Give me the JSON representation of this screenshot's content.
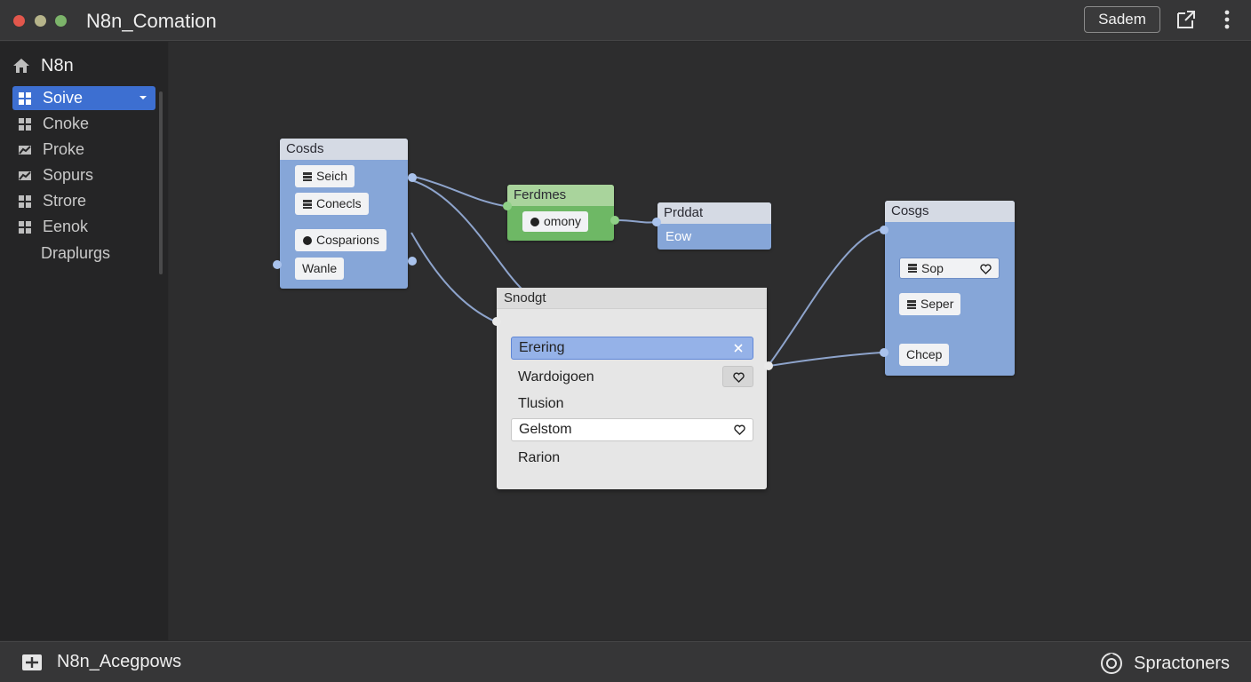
{
  "window": {
    "title": "N8n_Comation",
    "actions": {
      "primary_label": "Sadem",
      "export_icon": "export-icon",
      "menu_icon": "kebab-icon"
    }
  },
  "sidebar": {
    "home": {
      "label": "N8n",
      "icon": "home-icon"
    },
    "items": [
      {
        "label": "Soive",
        "icon": "grid-icon",
        "active": true
      },
      {
        "label": "Cnoke",
        "icon": "grid-icon"
      },
      {
        "label": "Proke",
        "icon": "chart-icon"
      },
      {
        "label": "Sopurs",
        "icon": "chart-icon"
      },
      {
        "label": "Strore",
        "icon": "grid-icon"
      },
      {
        "label": "Eenok",
        "icon": "grid-icon"
      },
      {
        "label": "Draplurgs",
        "icon": ""
      }
    ]
  },
  "canvas": {
    "nodes": {
      "cosds": {
        "title": "Cosds",
        "chips": [
          {
            "label": "Seich",
            "icon": "stack-icon"
          },
          {
            "label": "Conecls",
            "icon": "stack-icon"
          },
          {
            "label": "Cosparions",
            "icon": "dot-icon"
          },
          {
            "label": "Wanle",
            "icon": ""
          }
        ]
      },
      "ferdmes": {
        "title": "Ferdmes",
        "chips": [
          {
            "label": "omony",
            "icon": "dot-icon"
          }
        ]
      },
      "prddat": {
        "title": "Prddat",
        "body": "Eow"
      },
      "cosgs": {
        "title": "Cosgs",
        "chips": [
          {
            "label": "Sop",
            "icon": "stack-icon"
          },
          {
            "label": "Seper",
            "icon": "stack-icon"
          },
          {
            "label": "Chcep",
            "icon": ""
          }
        ]
      }
    },
    "panel": {
      "title": "Snodgt",
      "selected_field": "Erering",
      "rows": [
        "Wardoigoen",
        "Tlusion",
        "Rarion"
      ],
      "select_value": "Gelstom"
    }
  },
  "statusbar": {
    "left_label": "N8n_Acegpows",
    "left_icon": "add-workflow-icon",
    "right_label": "Spractoners",
    "right_icon": "settings-icon"
  },
  "colors": {
    "accent": "#3d6fd1",
    "node_blue": "#86a6d8",
    "node_green": "#6eb865",
    "wire": "#8ea4cc"
  }
}
